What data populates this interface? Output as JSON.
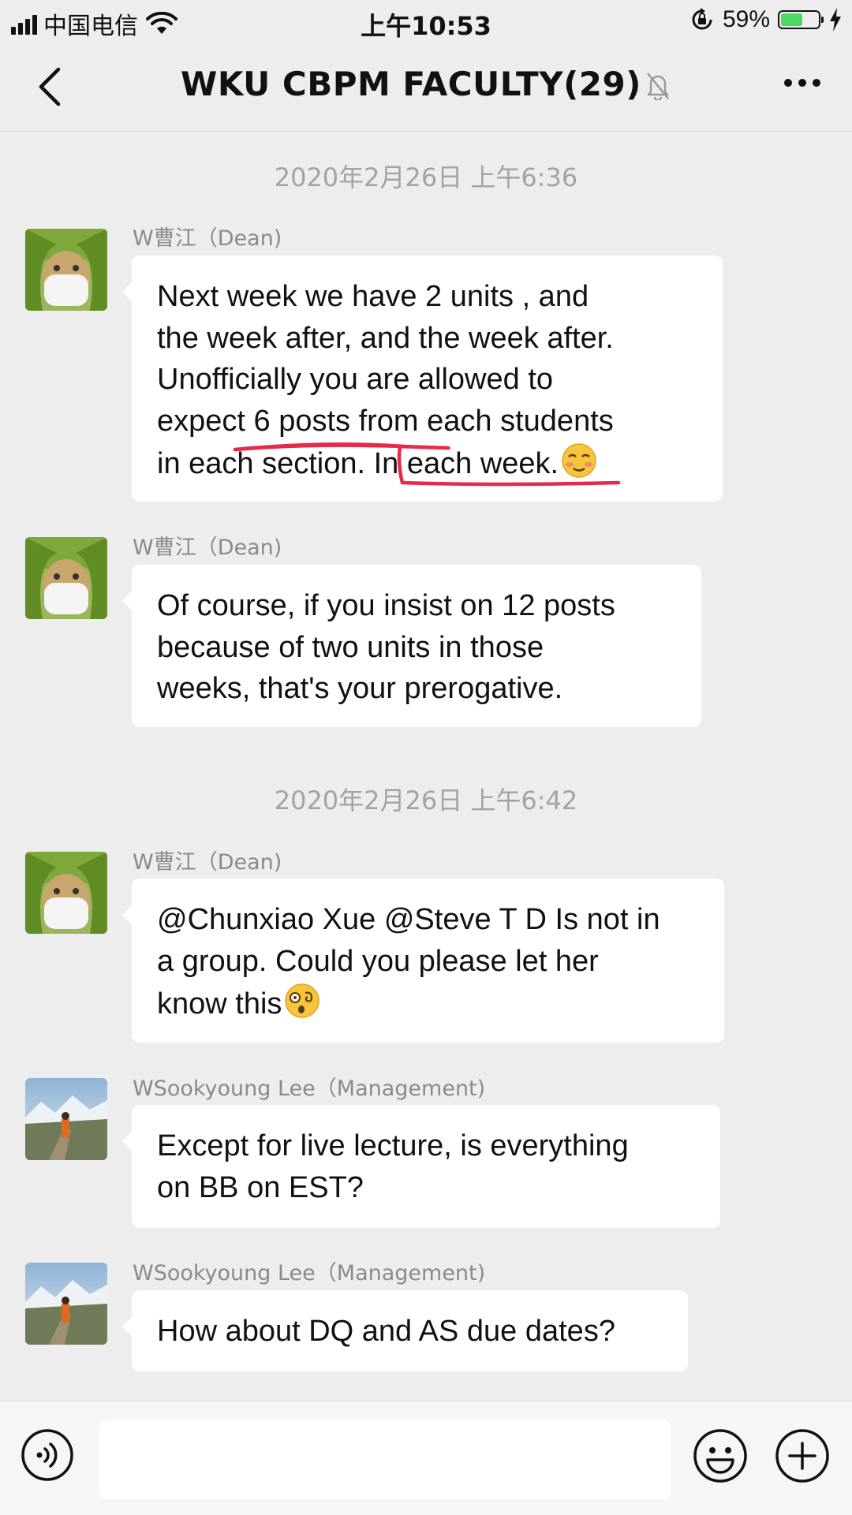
{
  "status_bar": {
    "carrier": "中国电信",
    "time": "上午10:53",
    "battery_percent": "59%",
    "battery_level": 0.59
  },
  "nav": {
    "title": "WKU CBPM FACULTY(29)",
    "back_icon": "chevron-left-icon",
    "mute_icon": "bell-slash-icon",
    "more_icon": "more-icon"
  },
  "messages": [
    {
      "sender": "W曹江（Dean)",
      "lines": [
        "Next week we have 2 units ,  and",
        "the week after,   and the week after.",
        " Unofficially you are allowed to",
        "expect 6 posts from each students",
        "in each section. In each week."
      ],
      "emoji": "flushed-emoji"
    },
    {
      "sender": "W曹江（Dean)",
      "lines": [
        "Of course, if you insist on 12 posts",
        "because of two units in those",
        "weeks, that's your prerogative."
      ]
    },
    {
      "sender": "W曹江（Dean)",
      "lines": [
        "@Chunxiao Xue @Steve T D Is not in",
        " a group. Could you please let her",
        "know this"
      ],
      "emoji": "dizzy-emoji"
    },
    {
      "sender": "WSookyoung Lee（Management)",
      "lines": [
        "Except for live lecture, is everything",
        "on BB on EST?"
      ]
    },
    {
      "sender": "WSookyoung Lee（Management)",
      "lines": [
        "How about DQ and AS due dates?"
      ]
    }
  ],
  "timestamps": [
    "2020年2月26日 上午6:36",
    "2020年2月26日 上午6:42"
  ],
  "input_bar": {
    "voice_icon": "voice-icon",
    "emoji_icon": "emoji-icon",
    "plus_icon": "plus-icon",
    "input_value": ""
  },
  "colors": {
    "background": "#ededed",
    "bubble": "#ffffff",
    "timestamp": "#a3a3a3",
    "annotation": "#e8294a",
    "battery": "#4cd964"
  }
}
